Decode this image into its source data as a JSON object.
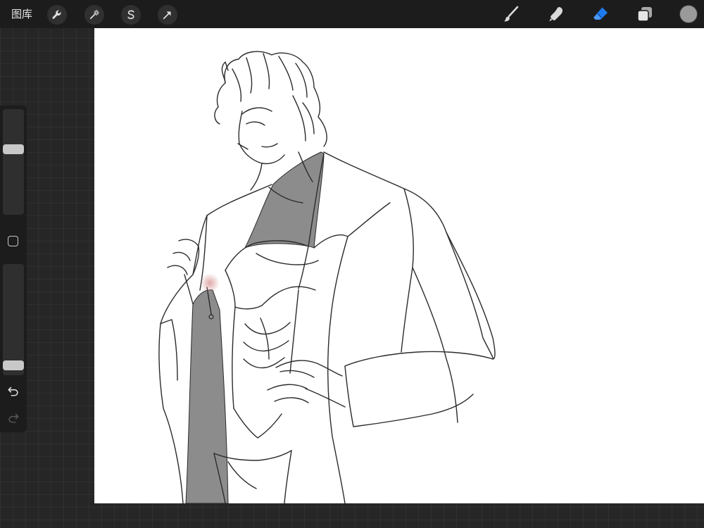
{
  "topbar": {
    "gallery_label": "图库",
    "left_tools": [
      {
        "name": "actions",
        "icon": "wrench-icon"
      },
      {
        "name": "adjustments",
        "icon": "magic-wand-icon"
      },
      {
        "name": "selection",
        "icon": "selection-s-icon"
      },
      {
        "name": "transform",
        "icon": "arrow-cursor-icon"
      }
    ],
    "right_tools": [
      {
        "name": "brush",
        "icon": "brush-icon",
        "active": false
      },
      {
        "name": "smudge",
        "icon": "smudge-icon",
        "active": false
      },
      {
        "name": "eraser",
        "icon": "eraser-icon",
        "active": true
      },
      {
        "name": "layers",
        "icon": "layers-icon",
        "active": false
      }
    ],
    "current_color": "#9a9a9a"
  },
  "sidebar": {
    "brush_size_level": 0.63,
    "opacity_level": 0.05,
    "buttons": [
      "modify-button",
      "undo-button",
      "redo-button"
    ]
  },
  "colors": {
    "accent": "#1e7bf0",
    "icon": "#d9d9d9",
    "app_background": "#262626",
    "bar_background": "#1c1c1c",
    "canvas": "#ffffff",
    "fill_gray": "#8c8c8c",
    "blush": "#d48c8c"
  }
}
